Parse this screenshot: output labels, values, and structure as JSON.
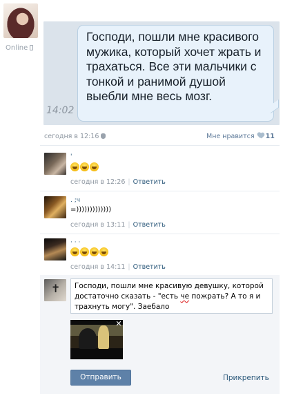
{
  "author": {
    "status": "Online"
  },
  "post": {
    "image_text": "Господи, пошли мне красивого мужика, который хочет жрать и трахаться. Все эти мальчики с тонкой и ранимой душой выебли мне весь мозг.",
    "image_time": "14:02",
    "timestamp": "сегодня в 12:16",
    "like_label": "Мне нравится",
    "like_count": "11"
  },
  "comments": [
    {
      "name": "'",
      "text": "",
      "emoji_count": 3,
      "time": "сегодня в 12:26",
      "reply": "Ответить"
    },
    {
      "name": ". ;ч",
      "text": "=)))))))))))))",
      "emoji_count": 0,
      "time": "сегодня в 13:11",
      "reply": "Ответить"
    },
    {
      "name": "· · ·",
      "text": "",
      "emoji_count": 4,
      "time": "сегодня в 14:11",
      "reply": "Ответить"
    }
  ],
  "reply_box": {
    "text_before": "Господи, пошли мне красивую девушку, которой достаточно сказать - \"есть ",
    "text_spell": "че",
    "text_after": " пожрать? А то я и трахнуть могу\". Заебало",
    "send_label": "Отправить",
    "attach_label": "Прикрепить"
  },
  "icons": {
    "device": "phone-icon",
    "platform": "apple-icon",
    "like": "heart-icon",
    "remove": "close-icon"
  }
}
